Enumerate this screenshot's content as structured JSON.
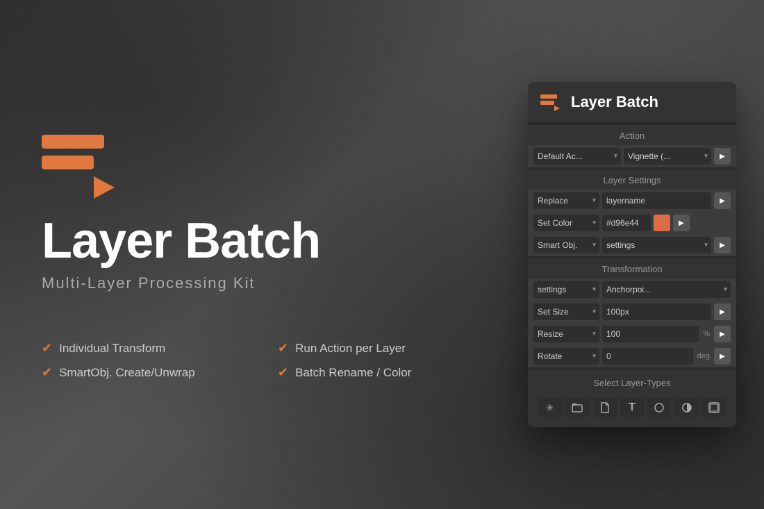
{
  "app": {
    "title": "Layer Batch",
    "subtitle": "Multi-Layer  Processing  Kit",
    "icon_color": "#e07840"
  },
  "features": [
    {
      "text": "Individual Transform"
    },
    {
      "text": "Run Action per Layer"
    },
    {
      "text": "SmartObj. Create/Unwrap"
    },
    {
      "text": "Batch Rename / Color"
    }
  ],
  "panel": {
    "header": {
      "title": "Layer Batch"
    },
    "sections": {
      "action": {
        "label": "Action",
        "dropdown1": "Default Ac...",
        "dropdown2": "Vignette (..."
      },
      "layer_settings": {
        "label": "Layer Settings",
        "row1_select": "Replace",
        "row1_input": "layername",
        "row2_select": "Set Color",
        "row2_color": "#d96e44",
        "row3_select": "Smart Obj.",
        "row3_input": "settings"
      },
      "transformation": {
        "label": "Transformation",
        "row1_select1": "settings",
        "row1_select2": "Anchorpoi...",
        "row2_select": "Set Size",
        "row2_value": "100px",
        "row3_select": "Resize",
        "row3_value": "100",
        "row3_unit": "%",
        "row4_select": "Rotate",
        "row4_value": "0",
        "row4_unit": "deg"
      },
      "select_layer_types": {
        "label": "Select Layer-Types",
        "buttons": [
          {
            "icon": "✳",
            "label": "all-layers",
            "active": false
          },
          {
            "icon": "⬜",
            "label": "group-layers",
            "active": false
          },
          {
            "icon": "🖿",
            "label": "file-layers",
            "active": false
          },
          {
            "icon": "T",
            "label": "text-layers",
            "active": false
          },
          {
            "icon": "⬤",
            "label": "shape-layers",
            "active": false
          },
          {
            "icon": "◑",
            "label": "adjustment-layers",
            "active": false
          },
          {
            "icon": "⊞",
            "label": "smart-objects",
            "active": false
          }
        ]
      }
    }
  }
}
